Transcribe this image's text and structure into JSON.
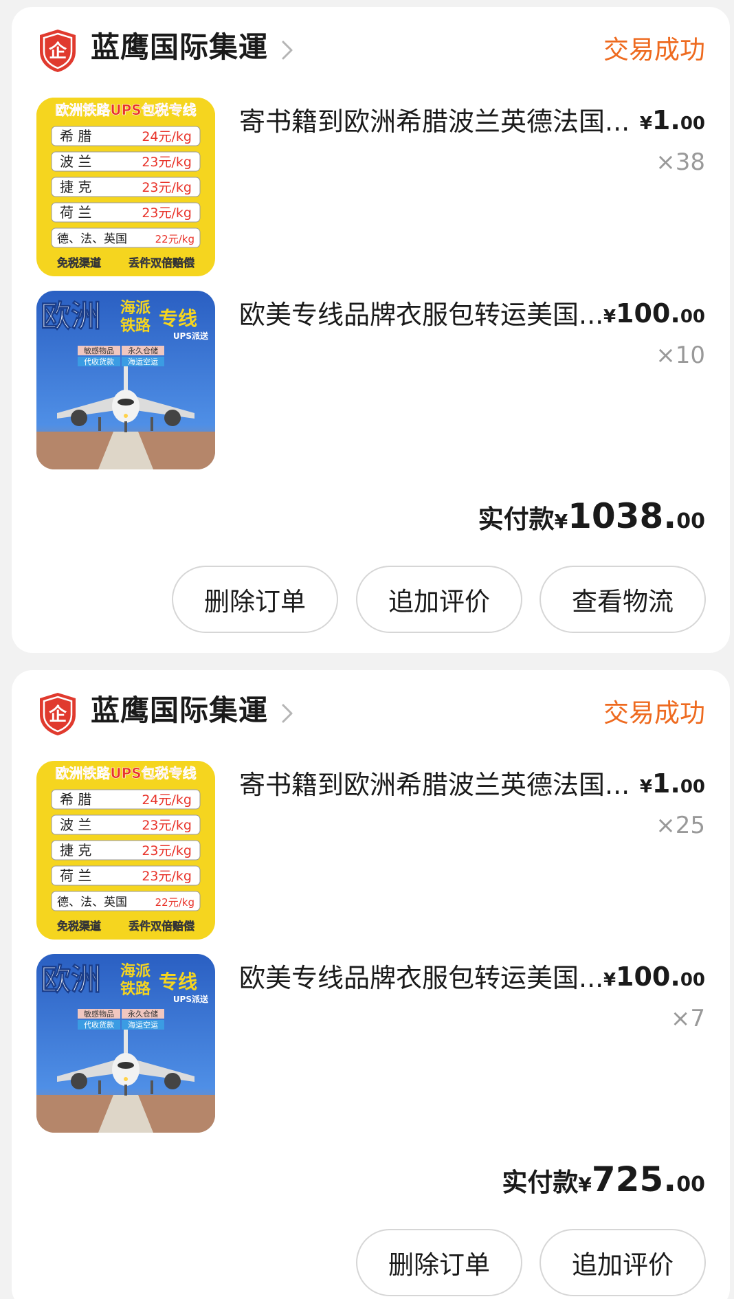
{
  "orders": [
    {
      "shop_name": "蓝鹰国际集運",
      "shop_badge_icon": "enterprise-shield-icon",
      "shop_badge_char": "企",
      "status": "交易成功",
      "items": [
        {
          "title": "寄书籍到欧洲希腊波兰英德法国...",
          "price_currency": "¥",
          "price_int": "1.",
          "price_dec": "00",
          "qty": "×38",
          "thumb": "rates"
        },
        {
          "title": "欧美专线品牌衣服包转运美国...",
          "price_currency": "¥",
          "price_int": "100.",
          "price_dec": "00",
          "qty": "×10",
          "thumb": "plane"
        }
      ],
      "total_label": "实付款",
      "total_currency": "¥",
      "total_int": "1038.",
      "total_dec": "00",
      "buttons": [
        "删除订单",
        "追加评价",
        "查看物流"
      ]
    },
    {
      "shop_name": "蓝鹰国际集運",
      "shop_badge_icon": "enterprise-shield-icon",
      "shop_badge_char": "企",
      "status": "交易成功",
      "items": [
        {
          "title": "寄书籍到欧洲希腊波兰英德法国...",
          "price_currency": "¥",
          "price_int": "1.",
          "price_dec": "00",
          "qty": "×25",
          "thumb": "rates"
        },
        {
          "title": "欧美专线品牌衣服包转运美国...",
          "price_currency": "¥",
          "price_int": "100.",
          "price_dec": "00",
          "qty": "×7",
          "thumb": "plane"
        }
      ],
      "total_label": "实付款",
      "total_currency": "¥",
      "total_int": "725.",
      "total_dec": "00",
      "buttons": [
        "删除订单",
        "追加评价"
      ]
    }
  ],
  "thumb_rates": {
    "banner": "欧洲铁路UPS包税专线",
    "rows": [
      {
        "country": "希 腊",
        "rate": "24元/kg"
      },
      {
        "country": "波 兰",
        "rate": "23元/kg"
      },
      {
        "country": "捷 克",
        "rate": "23元/kg"
      },
      {
        "country": "荷 兰",
        "rate": "23元/kg"
      },
      {
        "country": "德、法、英国",
        "rate": "22元/kg"
      }
    ],
    "footer_left": "免税渠道",
    "footer_right": "丢件双倍赔偿"
  },
  "thumb_plane": {
    "big": "欧洲",
    "small_1": "海派",
    "small_2": "铁路",
    "accent": "专线",
    "ups": "UPS派送",
    "tag_1": "敏感物品",
    "tag_2": "永久仓储",
    "tag_3": "代收货款",
    "tag_4": "海运空运"
  },
  "colors": {
    "status": "#ee6a1f",
    "badge_red": "#e03a2e",
    "rates_yellow": "#f5d51f",
    "plane_sky": "#1c57b8"
  }
}
